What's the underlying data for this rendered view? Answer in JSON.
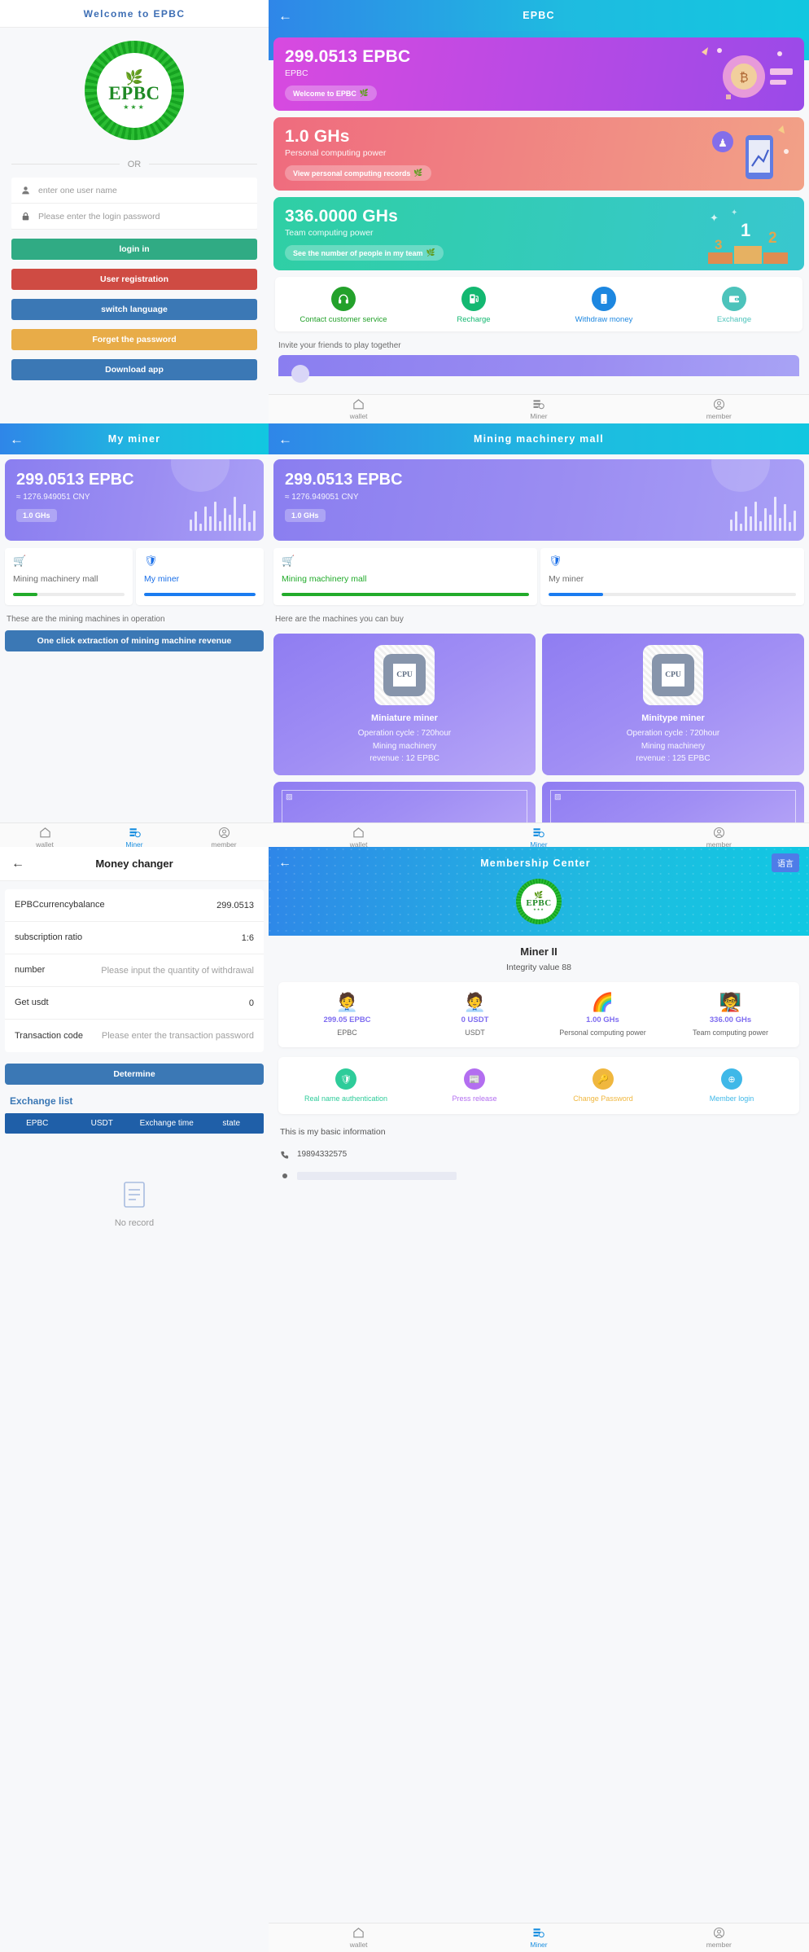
{
  "colors": {
    "green": "#30ab84",
    "red": "#cf4b43",
    "blue": "#3b78b5",
    "orange": "#e8ac48",
    "accent_cyan": "#10c8e2",
    "purple": "#9a4ae8",
    "brand_green": "#1f8a25"
  },
  "login": {
    "header_title": "Welcome to EPBC",
    "logo_text": "EPBC",
    "divider": "OR",
    "username_placeholder": "enter one user name",
    "password_placeholder": "Please enter the login password",
    "buttons": [
      {
        "label": "login in",
        "color": "green"
      },
      {
        "label": "User registration",
        "color": "red"
      },
      {
        "label": "switch language",
        "color": "blue"
      },
      {
        "label": "Forget the password",
        "color": "orange"
      },
      {
        "label": "Download app",
        "color": "blue"
      }
    ]
  },
  "home": {
    "header_title": "EPBC",
    "cards": [
      {
        "value": "299.0513 EPBC",
        "label": "EPBC",
        "pill": "Welcome to EPBC",
        "pill_icon": "leaf-icon",
        "theme": "purple"
      },
      {
        "value": "1.0 GHs",
        "label": "Personal computing power",
        "pill": "View personal computing records",
        "pill_icon": "leaf-icon",
        "theme": "pink"
      },
      {
        "value": "336.0000 GHs",
        "label": "Team computing power",
        "pill": "See the number of people in my team",
        "pill_icon": "leaf-icon",
        "theme": "teal"
      }
    ],
    "quick_actions": [
      {
        "label": "Contact customer service",
        "icon": "headset-icon",
        "color": "#23a12b"
      },
      {
        "label": "Recharge",
        "icon": "fuel-pump-icon",
        "color": "#13b871"
      },
      {
        "label": "Withdraw money",
        "icon": "phone-icon",
        "color": "#1d87e0"
      },
      {
        "label": "Exchange",
        "icon": "wallet-icon",
        "color": "#4cc3bb"
      }
    ],
    "invite_label": "Invite your friends to play together",
    "tabs": [
      {
        "label": "wallet",
        "icon": "home-icon",
        "active": false
      },
      {
        "label": "Miner",
        "icon": "server-icon",
        "active": false
      },
      {
        "label": "member",
        "icon": "user-circle-icon",
        "active": false
      }
    ]
  },
  "my_miner": {
    "header_title": "My miner",
    "balance": "299.0513 EPBC",
    "cny": "≈ 1276.949051 CNY",
    "ghs": "1.0 GHs",
    "tabs": [
      {
        "label": "Mining machinery mall",
        "icon": "cart-icon",
        "icon_color": "#22ab2b",
        "active": false,
        "progress": 22,
        "bar_color": "#22ab2b",
        "text_color": "#6d6d6d"
      },
      {
        "label": "My miner",
        "icon": "shield-icon",
        "icon_color": "#1a6fe8",
        "active": true,
        "progress": 100,
        "bar_color": "#1a7cf0",
        "text_color": "#1a6fe8"
      }
    ],
    "note": "These are the mining machines in operation",
    "extract_button": "One click extraction of mining machine revenue",
    "tabs_bottom": [
      {
        "label": "wallet",
        "icon": "home-icon",
        "active": false
      },
      {
        "label": "Miner",
        "icon": "server-icon",
        "active": true
      },
      {
        "label": "member",
        "icon": "user-circle-icon",
        "active": false
      }
    ]
  },
  "mall": {
    "header_title": "Mining machinery mall",
    "balance": "299.0513 EPBC",
    "cny": "≈ 1276.949051 CNY",
    "ghs": "1.0 GHs",
    "tabs": [
      {
        "label": "Mining machinery mall",
        "icon": "cart-icon",
        "icon_color": "#22ab2b",
        "active": true,
        "progress": 100,
        "bar_color": "#22ab2b",
        "text_color": "#22ab2b"
      },
      {
        "label": "My miner",
        "icon": "shield-icon",
        "icon_color": "#1a6fe8",
        "active": false,
        "progress": 22,
        "bar_color": "#1a7cf0",
        "text_color": "#6d6d6d"
      }
    ],
    "note": "Here are the machines you can buy",
    "machines": [
      {
        "name": "Miniature miner",
        "cycle": "Operation cycle : 720hour",
        "revenue_line1": "Mining machinery",
        "revenue_line2": "revenue : 12 EPBC",
        "image": "cpu-icon"
      },
      {
        "name": "Minitype miner",
        "cycle": "Operation cycle : 720hour",
        "revenue_line1": "Mining machinery",
        "revenue_line2": "revenue : 125 EPBC",
        "image": "cpu-icon"
      }
    ],
    "tabs_bottom": [
      {
        "label": "wallet",
        "icon": "home-icon",
        "active": false
      },
      {
        "label": "Miner",
        "icon": "server-icon",
        "active": true
      },
      {
        "label": "member",
        "icon": "user-circle-icon",
        "active": false
      }
    ]
  },
  "money_changer": {
    "header_title": "Money changer",
    "rows": [
      {
        "key": "EPBCcurrencybalance",
        "value": "299.0513",
        "is_placeholder": false
      },
      {
        "key": "subscription ratio",
        "value": "1:6",
        "is_placeholder": false
      },
      {
        "key": "number",
        "value": "Please input the quantity of withdrawal",
        "is_placeholder": true
      },
      {
        "key": "Get usdt",
        "value": "0",
        "is_placeholder": false
      },
      {
        "key": "Transaction code",
        "value": "Please enter the transaction password",
        "is_placeholder": true
      }
    ],
    "determine_button": "Determine",
    "exchange_list_title": "Exchange list",
    "table_headers": [
      "EPBC",
      "USDT",
      "Exchange time",
      "state"
    ],
    "empty_text": "No record",
    "empty_icon": "document-icon"
  },
  "membership": {
    "header_title": "Membership Center",
    "lang_button": "语言",
    "logo_text": "EPBC",
    "member_name": "Miner II",
    "integrity": "Integrity value 88",
    "stats": [
      {
        "emoji": "🧑‍💼",
        "value": "299.05 EPBC",
        "label": "EPBC"
      },
      {
        "emoji": "🧑‍💼",
        "value": "0 USDT",
        "label": "USDT"
      },
      {
        "emoji": "🌈",
        "value": "1.00 GHs",
        "label": "Personal computing power"
      },
      {
        "emoji": "🧑‍🏫",
        "value": "336.00 GHs",
        "label": "Team computing power"
      }
    ],
    "actions": [
      {
        "label": "Real name authentication",
        "icon": "shield-check-icon",
        "color": "#2ecc9a",
        "text_color": "#2ecc9a"
      },
      {
        "label": "Press release",
        "icon": "news-icon",
        "color": "#b36ef0",
        "text_color": "#b36ef0"
      },
      {
        "label": "Change Password",
        "icon": "key-icon",
        "color": "#f0b73e",
        "text_color": "#f0b73e"
      },
      {
        "label": "Member login",
        "icon": "login-icon",
        "color": "#3fb8e8",
        "text_color": "#3fb8e8"
      }
    ],
    "basic_label": "This is my basic information",
    "info": [
      {
        "icon": "phone-icon",
        "value": "19894332575"
      },
      {
        "icon": "bar-icon",
        "value": ""
      }
    ],
    "tabs_bottom": [
      {
        "label": "wallet",
        "icon": "home-icon",
        "active": false
      },
      {
        "label": "Miner",
        "icon": "server-icon",
        "active": true
      },
      {
        "label": "member",
        "icon": "user-circle-icon",
        "active": false
      }
    ]
  }
}
